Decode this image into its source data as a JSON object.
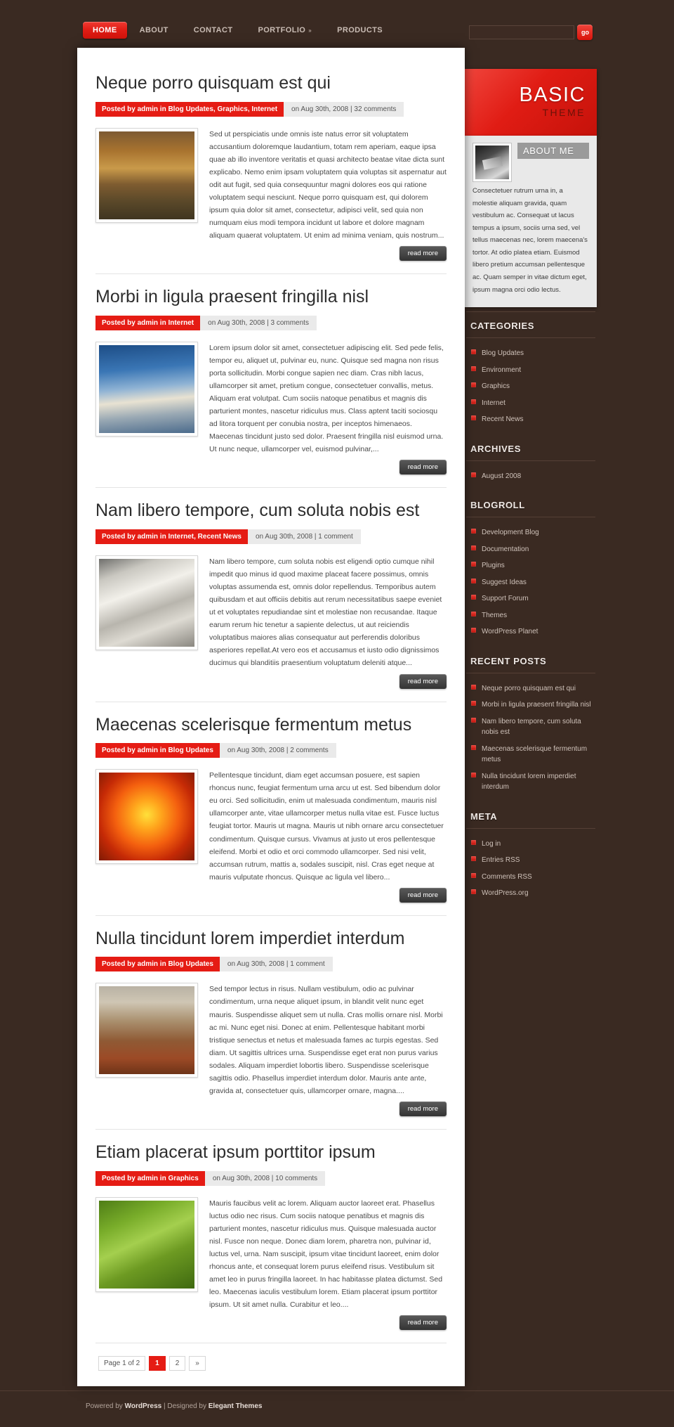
{
  "nav": {
    "items": [
      {
        "label": "HOME",
        "active": true,
        "caret": false
      },
      {
        "label": "ABOUT",
        "active": false,
        "caret": false
      },
      {
        "label": "CONTACT",
        "active": false,
        "caret": false
      },
      {
        "label": "PORTFOLIO",
        "active": false,
        "caret": true
      },
      {
        "label": "PRODUCTS",
        "active": false,
        "caret": false
      }
    ],
    "caret_glyph": "»"
  },
  "search": {
    "value": "",
    "placeholder": "",
    "button_label": "go"
  },
  "logo": {
    "main": "BASIC",
    "sub": "THEME"
  },
  "about": {
    "title": "ABOUT ME",
    "text": "Consectetuer rutrum urna in, a molestie aliquam gravida, quam vestibulum ac. Consequat ut lacus tempus a ipsum, sociis urna sed, vel tellus maecenas nec, lorem maecena's tortor. At odio platea etiam. Euismod libero pretium accumsan pellentesque ac. Quam semper in vitae dictum eget, ipsum magna orci odio lectus."
  },
  "widgets": [
    {
      "title": "CATEGORIES",
      "items": [
        "Blog Updates",
        "Environment",
        "Graphics",
        "Internet",
        "Recent News"
      ]
    },
    {
      "title": "ARCHIVES",
      "items": [
        "August 2008"
      ]
    },
    {
      "title": "BLOGROLL",
      "items": [
        "Development Blog",
        "Documentation",
        "Plugins",
        "Suggest Ideas",
        "Support Forum",
        "Themes",
        "WordPress Planet"
      ]
    },
    {
      "title": "RECENT POSTS",
      "items": [
        "Neque porro quisquam est qui",
        "Morbi in ligula praesent fringilla nisl",
        "Nam libero tempore, cum soluta nobis est",
        "Maecenas scelerisque fermentum metus",
        "Nulla tincidunt lorem imperdiet interdum"
      ]
    },
    {
      "title": "META",
      "items": [
        "Log in",
        "Entries RSS",
        "Comments RSS",
        "WordPress.org"
      ]
    }
  ],
  "posts": [
    {
      "title": "Neque porro quisquam est qui",
      "meta_red": "Posted by admin in Blog Updates, Graphics, Internet",
      "meta_grey": "on Aug 30th, 2008 | 32 comments",
      "excerpt": "Sed ut perspiciatis unde omnis iste natus error sit voluptatem accusantium doloremque laudantium, totam rem aperiam, eaque ipsa quae ab illo inventore veritatis et quasi architecto beatae vitae dicta sunt explicabo. Nemo enim ipsam voluptatem quia voluptas sit aspernatur aut odit aut fugit, sed quia consequuntur magni dolores eos qui ratione voluptatem sequi nesciunt. Neque porro quisquam est, qui dolorem ipsum quia dolor sit amet, consectetur, adipisci velit, sed quia non numquam eius modi tempora incidunt ut labore et dolore magnam aliquam quaerat voluptatem. Ut enim ad minima veniam, quis nostrum...",
      "read_more": "read more",
      "thumb": "autumn-road-photo"
    },
    {
      "title": "Morbi in ligula praesent fringilla nisl",
      "meta_red": "Posted by admin in Internet",
      "meta_grey": "on Aug 30th, 2008 | 3 comments",
      "excerpt": "Lorem ipsum dolor sit amet, consectetuer adipiscing elit. Sed pede felis, tempor eu, aliquet ut, pulvinar eu, nunc. Quisque sed magna non risus porta sollicitudin. Morbi congue sapien nec diam. Cras nibh lacus, ullamcorper sit amet, pretium congue, consectetuer convallis, metus. Aliquam erat volutpat. Cum sociis natoque penatibus et magnis dis parturient montes, nascetur ridiculus mus. Class aptent taciti sociosqu ad litora torquent per conubia nostra, per inceptos himenaeos. Maecenas tincidunt justo sed dolor. Praesent fringilla nisl euismod urna. Ut nunc neque, ullamcorper vel, euismod pulvinar,...",
      "read_more": "read more",
      "thumb": "sunbeam-clouds-photo"
    },
    {
      "title": "Nam libero tempore, cum soluta nobis est",
      "meta_red": "Posted by admin in Internet, Recent News",
      "meta_grey": "on Aug 30th, 2008 | 1 comment",
      "excerpt": "Nam libero tempore, cum soluta nobis est eligendi optio cumque nihil impedit quo minus id quod maxime placeat facere possimus, omnis voluptas assumenda est, omnis dolor repellendus. Temporibus autem quibusdam et aut officiis debitis aut rerum necessitatibus saepe eveniet ut et voluptates repudiandae sint et molestiae non recusandae. Itaque earum rerum hic tenetur a sapiente delectus, ut aut reiciendis voluptatibus maiores alias consequatur aut perferendis doloribus asperiores repellat.At vero eos et accusamus et iusto odio dignissimos ducimus qui blanditiis praesentium voluptatum deleniti atque...",
      "read_more": "read more",
      "thumb": "white-rock-photo"
    },
    {
      "title": "Maecenas scelerisque fermentum metus",
      "meta_red": "Posted by admin in Blog Updates",
      "meta_grey": "on Aug 30th, 2008 | 2 comments",
      "excerpt": "Pellentesque tincidunt, diam eget accumsan posuere, est sapien rhoncus nunc, feugiat fermentum urna arcu ut est. Sed bibendum dolor eu orci. Sed sollicitudin, enim ut malesuada condimentum, mauris nisl ullamcorper ante, vitae ullamcorper metus nulla vitae est. Fusce luctus feugiat tortor. Mauris ut magna. Mauris ut nibh ornare arcu consectetuer condimentum. Quisque cursus. Vivamus at justo ut eros pellentesque eleifend. Morbi et odio et orci commodo ullamcorper. Sed nisi velit, accumsan rutrum, mattis a, sodales suscipit, nisl. Cras eget neque at mauris vulputate rhoncus. Quisque ac ligula vel libero...",
      "read_more": "read more",
      "thumb": "orange-marigold-photo"
    },
    {
      "title": "Nulla tincidunt lorem imperdiet interdum",
      "meta_red": "Posted by admin in Blog Updates",
      "meta_grey": "on Aug 30th, 2008 | 1 comment",
      "excerpt": "Sed tempor lectus in risus. Nullam vestibulum, odio ac pulvinar condimentum, urna neque aliquet ipsum, in blandit velit nunc eget mauris. Suspendisse aliquet sem ut nulla. Cras mollis ornare nisl. Morbi ac mi. Nunc eget nisi. Donec at enim. Pellentesque habitant morbi tristique senectus et netus et malesuada fames ac turpis egestas. Sed diam. Ut sagittis ultrices urna. Suspendisse eget erat non purus varius sodales. Aliquam imperdiet lobortis libero. Suspendisse scelerisque sagittis odio. Phasellus imperdiet interdum dolor. Mauris ante ante, gravida at, consectetuer quis, ullamcorper ornare, magna....",
      "read_more": "read more",
      "thumb": "winter-forest-photo"
    },
    {
      "title": "Etiam placerat ipsum porttitor ipsum",
      "meta_red": "Posted by admin in Graphics",
      "meta_grey": "on Aug 30th, 2008 | 10 comments",
      "excerpt": "Mauris faucibus velit ac lorem. Aliquam auctor laoreet erat. Phasellus luctus odio nec risus. Cum sociis natoque penatibus et magnis dis parturient montes, nascetur ridiculus mus. Quisque malesuada auctor nisl. Fusce non neque. Donec diam lorem, pharetra non, pulvinar id, luctus vel, urna. Nam suscipit, ipsum vitae tincidunt laoreet, enim dolor rhoncus ante, et consequat lorem purus eleifend risus. Vestibulum sit amet leo in purus fringilla laoreet. In hac habitasse platea dictumst. Sed leo. Maecenas iaculis vestibulum lorem. Etiam placerat ipsum porttitor ipsum. Ut sit amet nulla. Curabitur et leo....",
      "read_more": "read more",
      "thumb": "green-dewdrop-leaf-photo"
    }
  ],
  "pagination": {
    "info": "Page 1 of 2",
    "pages": [
      "1",
      "2"
    ],
    "current": "1",
    "next_glyph": "»"
  },
  "footer": {
    "prefix": "Powered by ",
    "wordpress": "WordPress",
    "separator": " | Designed by ",
    "designer": "Elegant Themes"
  },
  "colors": {
    "accent_red": "#e51c14",
    "page_bg": "#3a2a22",
    "content_bg": "#ffffff",
    "sidebar_text": "#cfc2ba"
  }
}
